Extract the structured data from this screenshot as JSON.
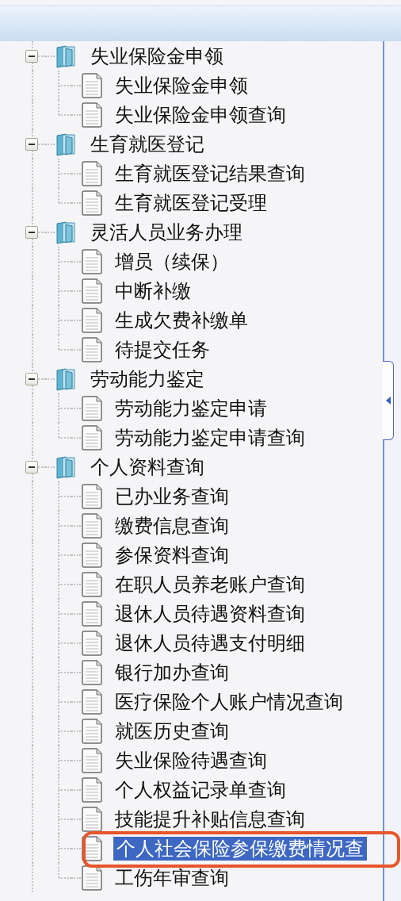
{
  "tree": [
    {
      "label": "失业保险金申领",
      "expanded": true,
      "children": [
        {
          "label": "失业保险金申领",
          "selected": false,
          "circled": false
        },
        {
          "label": "失业保险金申领查询",
          "selected": false,
          "circled": false
        }
      ]
    },
    {
      "label": "生育就医登记",
      "expanded": true,
      "children": [
        {
          "label": "生育就医登记结果查询",
          "selected": false,
          "circled": false
        },
        {
          "label": "生育就医登记受理",
          "selected": false,
          "circled": false
        }
      ]
    },
    {
      "label": "灵活人员业务办理",
      "expanded": true,
      "children": [
        {
          "label": "增员（续保）",
          "selected": false,
          "circled": false
        },
        {
          "label": "中断补缴",
          "selected": false,
          "circled": false
        },
        {
          "label": "生成欠费补缴单",
          "selected": false,
          "circled": false
        },
        {
          "label": "待提交任务",
          "selected": false,
          "circled": false
        }
      ]
    },
    {
      "label": "劳动能力鉴定",
      "expanded": true,
      "children": [
        {
          "label": "劳动能力鉴定申请",
          "selected": false,
          "circled": false
        },
        {
          "label": "劳动能力鉴定申请查询",
          "selected": false,
          "circled": false
        }
      ]
    },
    {
      "label": "个人资料查询",
      "expanded": true,
      "children": [
        {
          "label": "已办业务查询",
          "selected": false,
          "circled": false
        },
        {
          "label": "缴费信息查询",
          "selected": false,
          "circled": false
        },
        {
          "label": "参保资料查询",
          "selected": false,
          "circled": false
        },
        {
          "label": "在职人员养老账户查询",
          "selected": false,
          "circled": false
        },
        {
          "label": "退休人员待遇资料查询",
          "selected": false,
          "circled": false
        },
        {
          "label": "退休人员待遇支付明细",
          "selected": false,
          "circled": false
        },
        {
          "label": "银行加办查询",
          "selected": false,
          "circled": false
        },
        {
          "label": "医疗保险个人账户情况查询",
          "selected": false,
          "circled": false
        },
        {
          "label": "就医历史查询",
          "selected": false,
          "circled": false
        },
        {
          "label": "失业保险待遇查询",
          "selected": false,
          "circled": false
        },
        {
          "label": "个人权益记录单查询",
          "selected": false,
          "circled": false
        },
        {
          "label": "技能提升补贴信息查询",
          "selected": false,
          "circled": false
        },
        {
          "label": "个人社会保险参保缴费情况查",
          "selected": true,
          "circled": true
        },
        {
          "label": "工伤年审查询",
          "selected": false,
          "circled": false
        }
      ]
    }
  ]
}
